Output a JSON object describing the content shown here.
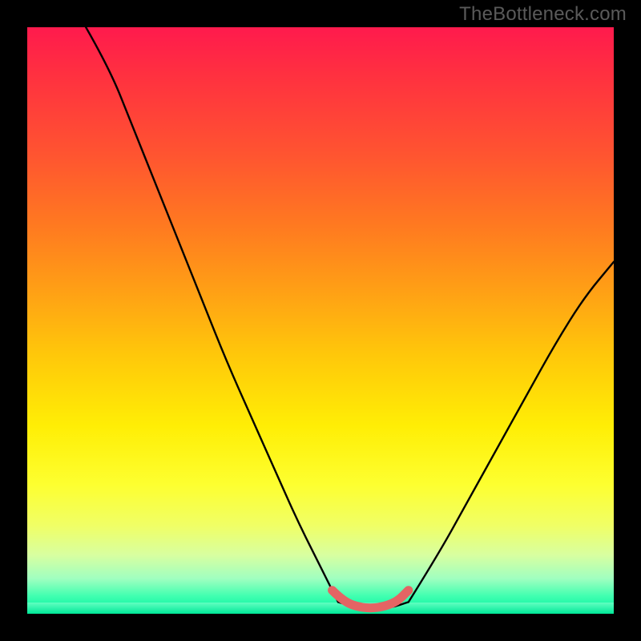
{
  "watermark": "TheBottleneck.com",
  "colors": {
    "background_black": "#000000",
    "gradient_top": "#ff1a4d",
    "gradient_bottom": "#00f0a0",
    "curve_stroke": "#000000",
    "highlight_stroke": "#e46464",
    "watermark_text": "#5a5a5a"
  },
  "chart_data": {
    "type": "line",
    "title": "",
    "subtitle": "",
    "xlabel": "",
    "ylabel": "",
    "xlim": [
      0,
      100
    ],
    "ylim": [
      0,
      100
    ],
    "grid": false,
    "legend": false,
    "annotations": [],
    "series": [
      {
        "name": "left-branch",
        "x": [
          10,
          14,
          18,
          22,
          26,
          30,
          34,
          38,
          42,
          46,
          50,
          53
        ],
        "y": [
          100,
          93,
          83,
          73,
          63,
          53,
          43,
          34,
          25,
          16,
          8,
          2
        ]
      },
      {
        "name": "trough",
        "x": [
          53,
          56,
          59,
          62,
          65
        ],
        "y": [
          2,
          1,
          1,
          1,
          2
        ]
      },
      {
        "name": "right-branch",
        "x": [
          65,
          70,
          75,
          80,
          85,
          90,
          95,
          100
        ],
        "y": [
          2,
          10,
          19,
          28,
          37,
          46,
          54,
          60
        ]
      },
      {
        "name": "highlighted-trough",
        "x": [
          52,
          54,
          57,
          60,
          63,
          65
        ],
        "y": [
          4,
          2,
          1,
          1,
          2,
          4
        ]
      }
    ]
  }
}
